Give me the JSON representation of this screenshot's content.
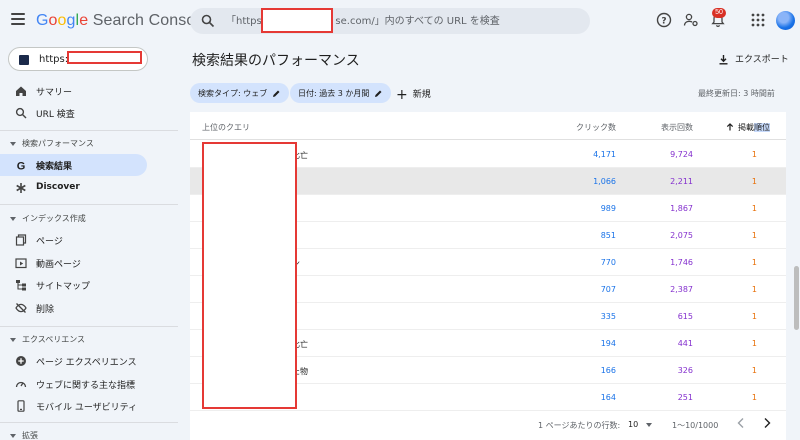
{
  "app": {
    "title_parts": [
      "G",
      "o",
      "o",
      "g",
      "l",
      "e"
    ],
    "title_suffix": " Search Console"
  },
  "search": {
    "placeholder": "「https://                    se.com/」内のすべての URL を検査"
  },
  "topbar": {
    "notification_count": "50"
  },
  "property": {
    "url": "https://"
  },
  "sidebar": {
    "items_top": [
      {
        "label": "サマリー",
        "icon": "home-icon"
      },
      {
        "label": "URL 検査",
        "icon": "search-icon"
      }
    ],
    "section_performance": "検索パフォーマンス",
    "items_performance": [
      {
        "label": "検索結果",
        "icon": "google-g-icon",
        "active": true
      },
      {
        "label": "Discover",
        "icon": "asterisk-icon"
      }
    ],
    "section_index": "インデックス作成",
    "items_index": [
      {
        "label": "ページ",
        "icon": "pages-icon"
      },
      {
        "label": "動画ページ",
        "icon": "video-page-icon"
      },
      {
        "label": "サイトマップ",
        "icon": "sitemap-icon"
      },
      {
        "label": "削除",
        "icon": "removal-icon"
      }
    ],
    "section_experience": "エクスペリエンス",
    "items_experience": [
      {
        "label": "ページ エクスペリエンス",
        "icon": "plus-circle-icon"
      },
      {
        "label": "ウェブに関する主な指標",
        "icon": "gauge-icon"
      },
      {
        "label": "モバイル ユーザビリティ",
        "icon": "mobile-icon"
      }
    ],
    "section_extensions": "拡張"
  },
  "main": {
    "title": "検索結果のパフォーマンス",
    "export_label": "エクスポート",
    "chip_search_type": "検索タイプ: ウェブ",
    "chip_date": "日付: 過去 3 か月間",
    "new_label": "新規",
    "last_updated": "最終更新日: 3 時間前"
  },
  "table": {
    "headers": {
      "query": "上位のクエリ",
      "clicks": "クリック数",
      "impressions": "表示回数",
      "position_prefix": "掲載",
      "position_highlight": "順位"
    },
    "rows": [
      {
        "query_tail": "比亡",
        "clicks": "4,171",
        "impressions": "9,724",
        "position": "1"
      },
      {
        "query_tail": "",
        "clicks": "1,066",
        "impressions": "2,211",
        "position": "1"
      },
      {
        "query_tail": "",
        "clicks": "989",
        "impressions": "1,867",
        "position": "1"
      },
      {
        "query_tail": "",
        "clicks": "851",
        "impressions": "2,075",
        "position": "1"
      },
      {
        "query_tail": "ン",
        "clicks": "770",
        "impressions": "1,746",
        "position": "1"
      },
      {
        "query_tail": "",
        "clicks": "707",
        "impressions": "2,387",
        "position": "1"
      },
      {
        "query_tail": "",
        "clicks": "335",
        "impressions": "615",
        "position": "1"
      },
      {
        "query_tail": "比亡",
        "clicks": "194",
        "impressions": "441",
        "position": "1"
      },
      {
        "query_tail": "た物",
        "clicks": "166",
        "impressions": "326",
        "position": "1"
      },
      {
        "query_tail": "",
        "clicks": "164",
        "impressions": "251",
        "position": "1"
      }
    ],
    "pager": {
      "rows_per_page_label": "1 ページあたりの行数:",
      "rows_per_page_value": "10",
      "range": "1〜10/1000"
    }
  },
  "colors": {
    "clicks": "#1a73e8",
    "impressions": "#8430ce",
    "position": "#e8710a",
    "accent_chip": "#d3e3fd",
    "redaction": "#e53935"
  }
}
